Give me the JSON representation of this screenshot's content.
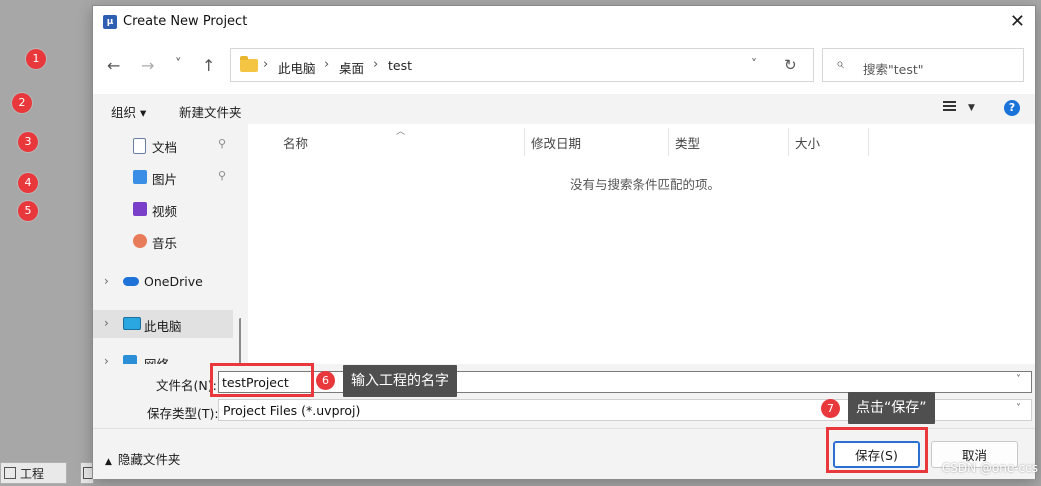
{
  "background_markers": [
    "1",
    "2",
    "3",
    "4",
    "5"
  ],
  "taskbar": {
    "tabs": [
      "工程",
      ""
    ]
  },
  "dialog": {
    "title": "Create New Project",
    "title_icon": "μ",
    "close_glyph": "✕",
    "nav": {
      "back": "←",
      "forward": "→",
      "recent": "˅",
      "up": "↑"
    },
    "address": {
      "crumbs": [
        "此电脑",
        "桌面",
        "test"
      ],
      "separator": "›",
      "dropdown": "˅",
      "refresh": "↻"
    },
    "search": {
      "placeholder": "搜索\"test\""
    },
    "toolbar": {
      "organize": "组织 ▾",
      "new_folder": "新建文件夹",
      "help": "?"
    },
    "navpane": {
      "items": [
        {
          "label": "文档",
          "pinned": true
        },
        {
          "label": "图片",
          "pinned": true
        },
        {
          "label": "视频",
          "pinned": false
        },
        {
          "label": "音乐",
          "pinned": false
        },
        {
          "label": "OneDrive",
          "pinned": false
        },
        {
          "label": "此电脑",
          "pinned": false,
          "selected": true
        },
        {
          "label": "网络",
          "pinned": false
        }
      ],
      "pin_glyph": "📌",
      "chevron": "›"
    },
    "columns": [
      "名称",
      "修改日期",
      "类型",
      "大小"
    ],
    "empty_message": "没有与搜索条件匹配的项。",
    "filename": {
      "label": "文件名(N):",
      "value": "testProject"
    },
    "filetype": {
      "label": "保存类型(T):",
      "value": "Project Files (*.uvproj)"
    },
    "hide_folders": "隐藏文件夹",
    "buttons": {
      "save": "保存(S)",
      "cancel": "取消"
    }
  },
  "annotations": [
    {
      "number": "6",
      "text": "输入工程的名字"
    },
    {
      "number": "7",
      "text": "点击“保存”"
    }
  ],
  "watermark": "CSDN @one-ccs"
}
